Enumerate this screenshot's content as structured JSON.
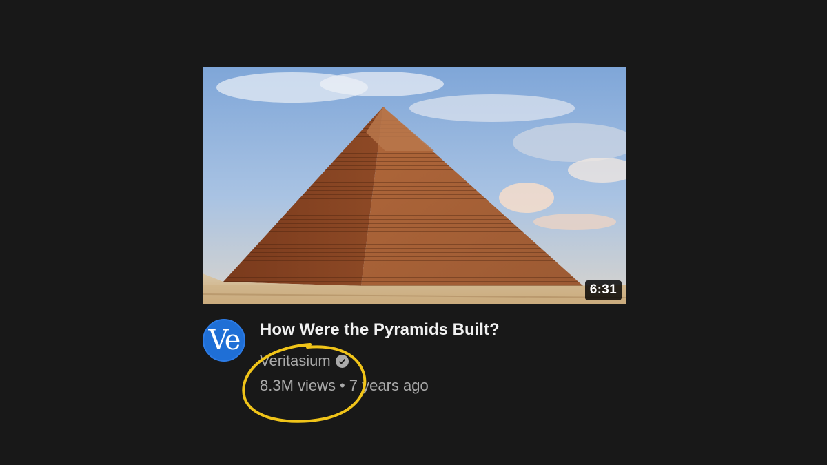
{
  "video": {
    "duration": "6:31",
    "title": "How Were the Pyramids Built?",
    "channel": "Veritasium",
    "avatar_text": "Ve",
    "views": "8.3M views",
    "separator": "•",
    "age": "7 years ago"
  },
  "icons": {
    "verified": "verified-check-icon"
  },
  "colors": {
    "background": "#181818",
    "avatar": "#1f6fd6",
    "annotation": "#f0c419",
    "meta_text": "#aaaaaa"
  }
}
